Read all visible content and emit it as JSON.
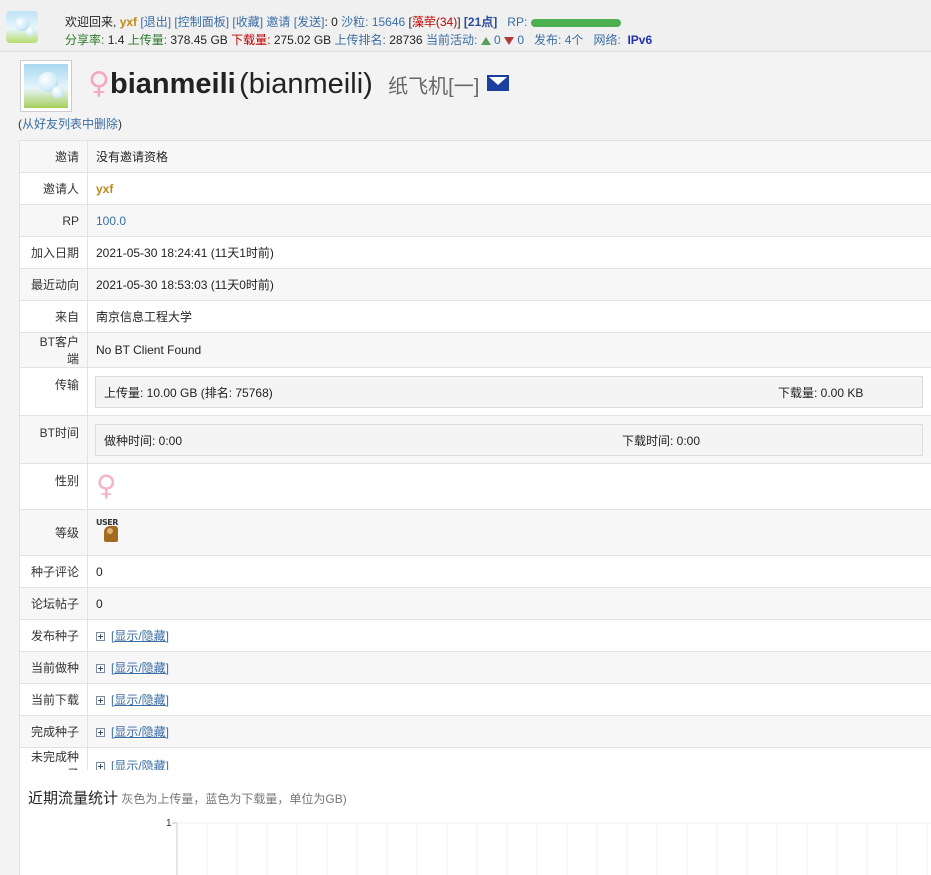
{
  "topbar": {
    "welcome": "欢迎回来,",
    "username": "yxf",
    "logout": "[退出]",
    "control_panel": "[控制面板]",
    "favorites": "[收藏]",
    "invite": "邀请",
    "send": "[发送]",
    "invite_count": ": 0",
    "bonus_label": "沙粒",
    "bonus_value": ": 15646",
    "flowers_prefix": "[",
    "flowers": "藻荦(34)",
    "flowers_suffix": "]",
    "points": "[21点]",
    "rp_label": "RP:",
    "rp_fill": 1.0,
    "share_ratio_label": "分享率:",
    "share_ratio": "1.4",
    "upload_label": "上传量:",
    "upload": "378.45 GB",
    "download_label": "下载量:",
    "download": "275.02 GB",
    "upload_rank_label": "上传排名:",
    "upload_rank": "28736",
    "activity_label": "当前活动:",
    "seeding_count": "0",
    "leeching_count": "0",
    "publish_label": "发布:",
    "publish_count": "4个",
    "network_label": "网络:",
    "network": "IPv6"
  },
  "profile": {
    "gender_symbol": "♀",
    "username": "bianmeili",
    "display_name": "(bianmeili)",
    "class": "纸飞机[一]",
    "remove_friend": "从好友列表中删除",
    "paren_open": "(",
    "paren_close": ")"
  },
  "details": {
    "invite": {
      "label": "邀请",
      "value": "没有邀请资格"
    },
    "inviter": {
      "label": "邀请人",
      "value": "yxf"
    },
    "rp": {
      "label": "RP",
      "value": "100.0"
    },
    "join_date": {
      "label": "加入日期",
      "value": "2021-05-30 18:24:41 (11天1时前)"
    },
    "last_seen": {
      "label": "最近动向",
      "value": "2021-05-30 18:53:03 (11天0时前)"
    },
    "from": {
      "label": "来自",
      "value": "南京信息工程大学"
    },
    "bt_client": {
      "label": "BT客户端",
      "value": "No BT Client Found"
    },
    "transfer": {
      "label": "传输",
      "upload": "上传量: 10.00 GB (排名: 75768)",
      "download": "下载量: 0.00 KB"
    },
    "bt_time": {
      "label": "BT时间",
      "seed_time": "做种时间: 0:00",
      "leech_time": "下载时间: 0:00"
    },
    "gender": {
      "label": "性别",
      "symbol": "♀"
    },
    "level": {
      "label": "等级",
      "icon_text": "USER"
    },
    "torrent_comments": {
      "label": "种子评论",
      "value": "0"
    },
    "forum_posts": {
      "label": "论坛帖子",
      "value": "0"
    },
    "uploaded_torrents": {
      "label": "发布种子",
      "toggle": "[显示/隐藏]"
    },
    "seeding": {
      "label": "当前做种",
      "toggle": "[显示/隐藏]"
    },
    "leeching": {
      "label": "当前下载",
      "toggle": "[显示/隐藏]"
    },
    "completed": {
      "label": "完成种子",
      "toggle": "[显示/隐藏]"
    },
    "incomplete": {
      "label": "未完成种子",
      "toggle": "[显示/隐藏]"
    }
  },
  "stats": {
    "title": "近期流量统计",
    "note": "灰色为上传量，蓝色为下载量，单位为GB)",
    "y_tick": "1"
  },
  "colors": {
    "accent_blue": "#3a6ea5",
    "gold": "#c08a1a",
    "red": "#c00000",
    "rp_green": "#4caf50"
  }
}
